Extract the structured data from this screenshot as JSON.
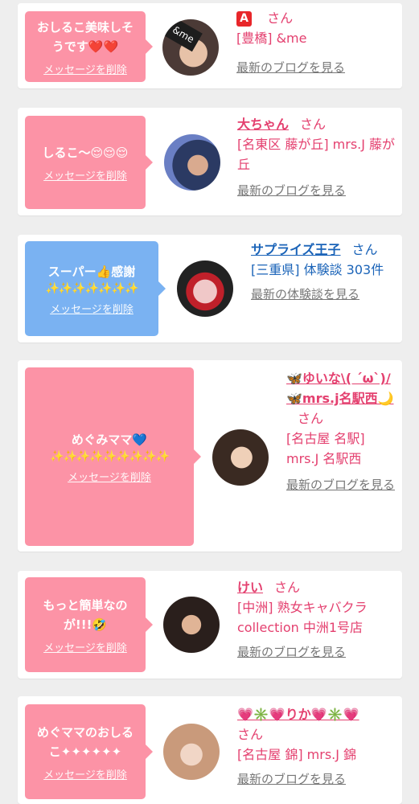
{
  "cards": [
    {
      "message": "おしるこ美味しそうです❤️❤️",
      "delete": "メッセージを削除",
      "avatar_text": "&me",
      "name_badge": "A",
      "name": "",
      "san": "さん",
      "location": "[豊橋] &me",
      "link": "最新のブログを見る"
    },
    {
      "message": "しるこ〜😌😌😌",
      "delete": "メッセージを削除",
      "name": "大ちゃん",
      "san": "さん",
      "location": "[名東区 藤が丘] mrs.J 藤が丘",
      "link": "最新のブログを見る"
    },
    {
      "message": "スーパー👍感謝",
      "sparkles": "✨✨✨✨✨✨✨",
      "delete": "メッセージを削除",
      "name": "サプライズ王子",
      "san": "さん",
      "location": "[三重県] 体験談 303件",
      "link": "最新の体験談を見る"
    },
    {
      "message": "めぐみママ💙",
      "sparkles": "✨✨✨✨✨✨✨✨✨",
      "delete": "メッセージを削除",
      "name": "🦋ゆいな\\( ´ω`)/🦋mrs.j名駅西🌙",
      "san": "さん",
      "location": "[名古屋 名駅] mrs.J 名駅西",
      "link": "最新のブログを見る"
    },
    {
      "message": "もっと簡単なのが!!!🤣",
      "delete": "メッセージを削除",
      "name": "けい",
      "san": "さん",
      "location": "[中洲] 熟女キャバクラcollection 中洲1号店",
      "link": "最新のブログを見る"
    },
    {
      "message": "めぐママのおしるこ✦✦✦✦✦✦",
      "delete": "メッセージを削除",
      "name": "💗✳️💗りか💗✳️💗",
      "san": "さん",
      "location": "[名古屋 錦] mrs.J 錦",
      "link": "最新のブログを見る"
    }
  ],
  "colors": {
    "pink_bubble": "#fc93a6",
    "blue_bubble": "#7ab2f2",
    "pink_text": "#e4406f",
    "blue_text": "#1a63b8"
  }
}
